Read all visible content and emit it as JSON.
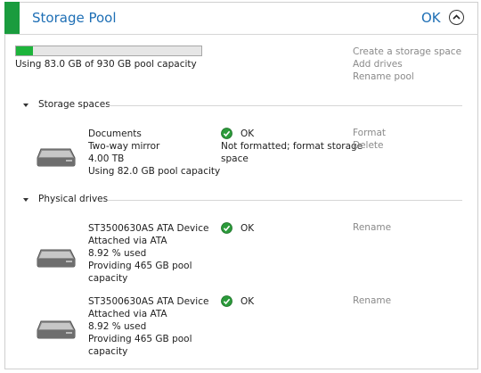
{
  "header": {
    "title": "Storage Pool",
    "status": "OK",
    "accent_color": "#1a9c3e",
    "collapse_icon": "chevron-up-circle-icon"
  },
  "pool": {
    "capacity_used_fraction": 0.089,
    "capacity_text": "Using 83.0 GB of 930 GB pool capacity",
    "fill_color": "#1db43b"
  },
  "actions": {
    "create_space": "Create a storage space",
    "add_drives": "Add drives",
    "rename_pool": "Rename pool"
  },
  "storage_spaces": {
    "label": "Storage spaces",
    "items": [
      {
        "name": "Documents",
        "layout": "Two-way mirror",
        "size": "4.00 TB",
        "usage": "Using 82.0 GB pool capacity",
        "status": "OK",
        "status_detail_1": "Not formatted; format storage",
        "status_detail_2": "space",
        "action_format": "Format",
        "action_delete": "Delete"
      }
    ]
  },
  "physical_drives": {
    "label": "Physical drives",
    "items": [
      {
        "name": "ST3500630AS ATA Device",
        "connection": "Attached via ATA",
        "used": "8.92 % used",
        "providing_1": "Providing 465 GB pool",
        "providing_2": "capacity",
        "status": "OK",
        "action": "Rename"
      },
      {
        "name": "ST3500630AS ATA Device",
        "connection": "Attached via ATA",
        "used": "8.92 % used",
        "providing_1": "Providing 465 GB pool",
        "providing_2": "capacity",
        "status": "OK",
        "action": "Rename"
      }
    ]
  }
}
